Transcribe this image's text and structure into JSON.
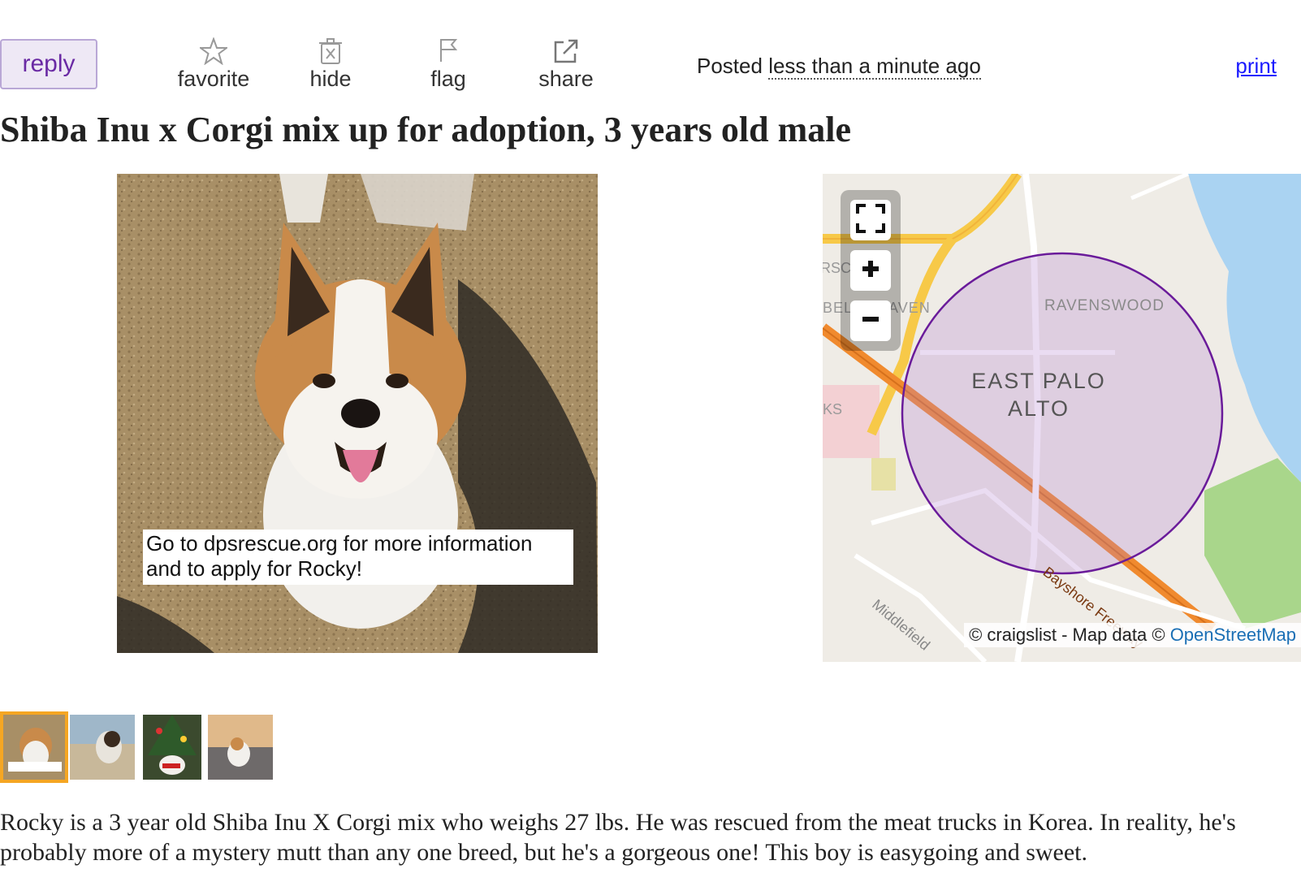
{
  "actions": {
    "reply": "reply",
    "favorite": "favorite",
    "hide": "hide",
    "flag": "flag",
    "share": "share"
  },
  "posted": {
    "prefix": "Posted",
    "time": "less than a minute ago"
  },
  "print": "print",
  "title": "Shiba Inu x Corgi mix up for adoption, 3 years old male",
  "photo": {
    "caption": "Go to dpsrescue.org for more information and to apply for Rocky!"
  },
  "map": {
    "labels": {
      "city": "EAST PALO",
      "city2": "ALTO",
      "ravenswood": "RAVENSWOOD",
      "belle_haven": "BELLE HAVEN",
      "freeway": "Bayshore Freeway",
      "middlefield": "Middlefield",
      "edge1": "RSC",
      "edge2": "KS"
    },
    "attribution": "© craigslist - Map data ©",
    "attribution_link": "OpenStreetMap",
    "colors": {
      "radius": "#6a1b9a",
      "highway": "#f08a2e",
      "road": "#f7c948",
      "water": "#aad3f2"
    }
  },
  "thumbnails": [
    "Rocky with caption",
    "Rocky on beach",
    "Rocky by Christmas tree",
    "Rocky at sunset"
  ],
  "description": "Rocky is a 3 year old Shiba Inu X Corgi mix who weighs 27 lbs. He was rescued from the meat trucks in Korea. In reality, he's probably more of a mystery mutt than any one breed, but he's a gorgeous one! This boy is easygoing and sweet."
}
